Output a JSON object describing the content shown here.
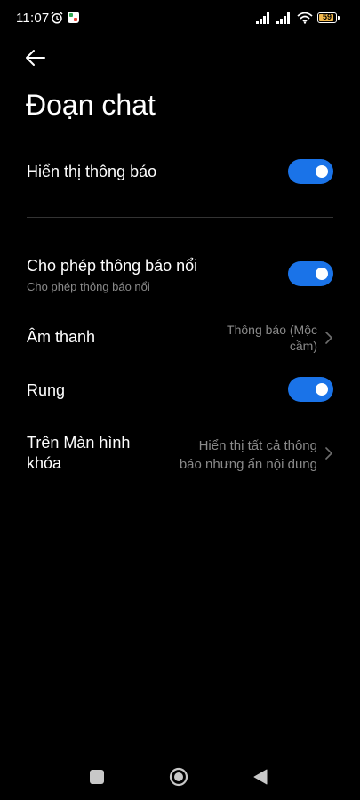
{
  "status_bar": {
    "time": "11:07",
    "battery_level": "59"
  },
  "header": {
    "title": "Đoạn chat"
  },
  "settings": {
    "show_notifications": {
      "title": "Hiển thị thông báo",
      "enabled": true
    },
    "floating_notifications": {
      "title": "Cho phép thông báo nổi",
      "subtitle": "Cho phép thông báo nổi",
      "enabled": true
    },
    "sound": {
      "title": "Âm thanh",
      "value_line1": "Thông báo (Mộc",
      "value_line2": "cầm)"
    },
    "vibrate": {
      "title": "Rung",
      "enabled": true
    },
    "lock_screen": {
      "title_line1": "Trên Màn hình",
      "title_line2": "khóa",
      "value_line1": "Hiển thị tất cả thông",
      "value_line2": "báo nhưng ẩn nội dung"
    }
  },
  "colors": {
    "background": "#000000",
    "toggle_on": "#1a73e8",
    "secondary_text": "#8a8a8a",
    "battery_fill": "#f2b84b"
  },
  "icons": {
    "back": "arrow-left-icon",
    "alarm": "alarm-clock-icon",
    "signal": "cellular-signal-icon",
    "wifi": "wifi-icon",
    "battery": "battery-icon",
    "chevron": "chevron-right-icon",
    "nav_recent": "square-icon",
    "nav_home": "circle-icon",
    "nav_back": "triangle-left-icon"
  }
}
